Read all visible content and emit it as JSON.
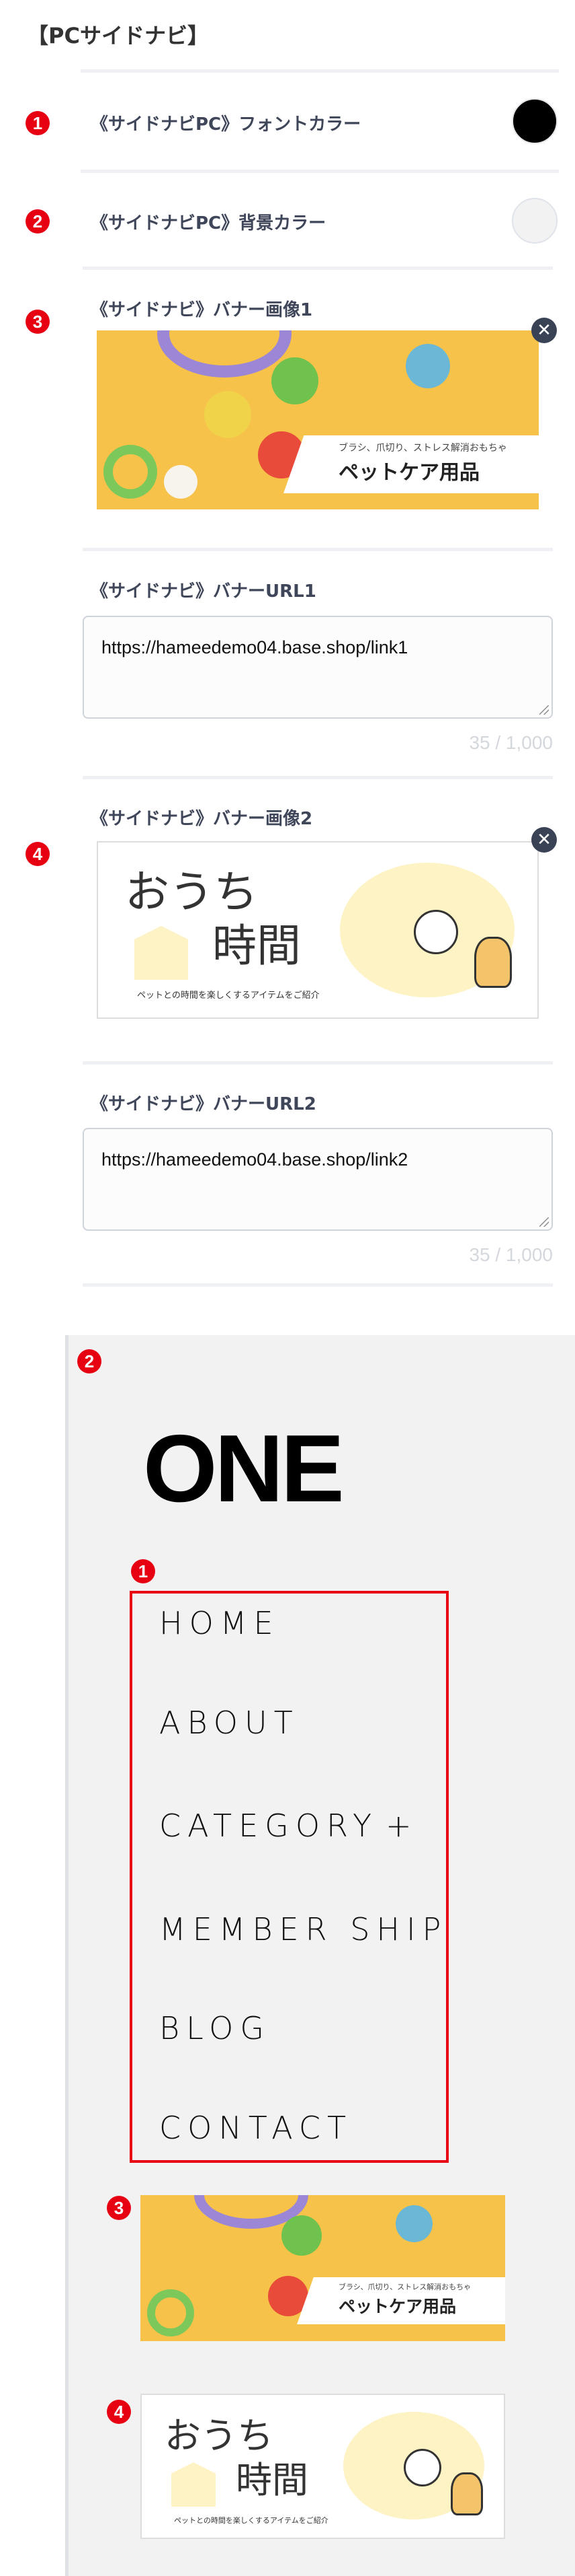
{
  "section_title": "【PCサイドナビ】",
  "settings": {
    "font_color": {
      "badge": "1",
      "label": "《サイドナビPC》フォントカラー",
      "value": "#000000"
    },
    "bg_color": {
      "badge": "2",
      "label": "《サイドナビPC》背景カラー",
      "value": "#f2f2f2"
    },
    "banner1": {
      "badge": "3",
      "label": "《サイドナビ》バナー画像1",
      "close_icon": "close-icon",
      "close_glyph": "✕"
    },
    "url1": {
      "label": "《サイドナビ》バナーURL1",
      "value": "https://hameedemo04.base.shop/link1",
      "count": "35 / 1,000"
    },
    "banner2": {
      "badge": "4",
      "label": "《サイドナビ》バナー画像2",
      "close_icon": "close-icon",
      "close_glyph": "✕"
    },
    "url2": {
      "label": "《サイドナビ》バナーURL2",
      "value": "https://hameedemo04.base.shop/link2",
      "count": "35 / 1,000"
    }
  },
  "banner_pet": {
    "sub": "ブラシ、爪切り、ストレス解消おもちゃ",
    "main": "ペットケア用品"
  },
  "banner_home": {
    "title_line1": "おうち",
    "title_line2": "時間",
    "sub": "ペットとの時間を楽しくするアイテムをご紹介"
  },
  "preview": {
    "badges": {
      "bg": "2",
      "nav": "1",
      "banner1": "3",
      "banner2": "4"
    },
    "logo": "ONE",
    "nav_items": [
      "HOME",
      "ABOUT",
      "CATEGORY",
      "MEMBER SHIP",
      "BLOG",
      "CONTACT"
    ],
    "category_expand": "+"
  },
  "colors": {
    "badge": "#e60012",
    "label": "#3f4659",
    "preview_bg": "#f2f2f2",
    "highlight_box": "#e60012"
  }
}
